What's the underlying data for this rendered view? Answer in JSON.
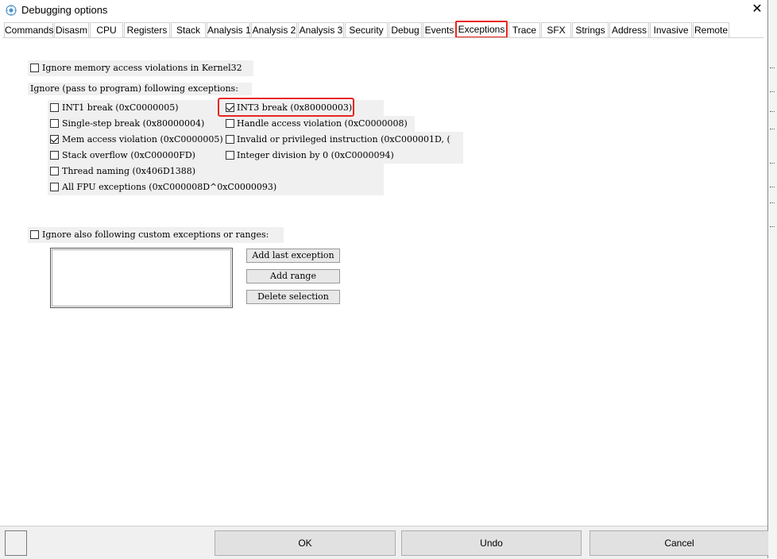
{
  "window": {
    "title": "Debugging options",
    "close_glyph": "✕"
  },
  "tabs": [
    "Commands",
    "Disasm",
    "CPU",
    "Registers",
    "Stack",
    "Analysis 1",
    "Analysis 2",
    "Analysis 3",
    "Security",
    "Debug",
    "Events",
    "Exceptions",
    "Trace",
    "SFX",
    "Strings",
    "Address",
    "Invasive",
    "Remote"
  ],
  "active_tab": "Exceptions",
  "options": {
    "ignore_kernel32": {
      "label": "Ignore memory access violations in Kernel32",
      "checked": false
    },
    "ignore_pass_heading": "Ignore (pass to program) following exceptions:",
    "int1": {
      "label": "INT1 break (0xC0000005)",
      "checked": false
    },
    "int3": {
      "label": "INT3 break (0x80000003)",
      "checked": true
    },
    "single_step": {
      "label": "Single-step break (0x80000004)",
      "checked": false
    },
    "handle_access": {
      "label": "Handle access violation (0xC0000008)",
      "checked": false
    },
    "mem_access": {
      "label": "Mem access violation (0xC0000005)",
      "checked": true
    },
    "invalid_instr": {
      "label": "Invalid or privileged instruction (0xC000001D, (",
      "checked": false
    },
    "stack_overflow": {
      "label": "Stack overflow (0xC00000FD)",
      "checked": false
    },
    "int_div": {
      "label": "Integer division by 0 (0xC0000094)",
      "checked": false
    },
    "thread_naming": {
      "label": "Thread naming (0x406D1388)",
      "checked": false
    },
    "fpu": {
      "label": "All FPU exceptions (0xC000008D^0xC0000093)",
      "checked": false
    },
    "custom": {
      "label": "Ignore also following custom exceptions or ranges:",
      "checked": false
    }
  },
  "buttons": {
    "add_last": "Add last exception",
    "add_range": "Add range",
    "delete_sel": "Delete selection",
    "ok": "OK",
    "undo": "Undo",
    "cancel": "Cancel"
  },
  "colors": {
    "highlight": "#e8261f",
    "panel_grey": "#f0f0f0"
  }
}
